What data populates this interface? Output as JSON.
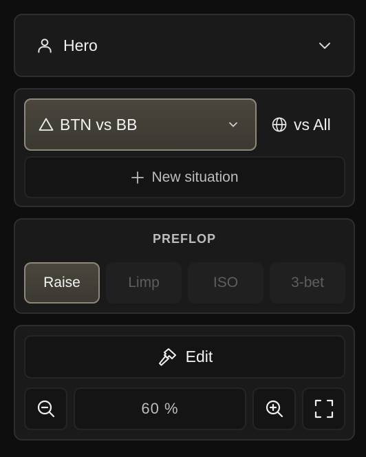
{
  "profile": {
    "name": "Hero",
    "icon": "user-icon",
    "dropdown_icon": "chevron-down-icon"
  },
  "situation": {
    "selected": "BTN vs BB",
    "selected_icon": "triangle-icon",
    "dropdown_icon": "chevron-down-icon",
    "opponent_filter": "vs All",
    "opponent_filter_icon": "globe-icon",
    "new_label": "New situation",
    "new_icon": "plus-icon"
  },
  "preflop": {
    "title": "PREFLOP",
    "actions": [
      {
        "label": "Raise",
        "active": true
      },
      {
        "label": "Limp",
        "active": false
      },
      {
        "label": "ISO",
        "active": false
      },
      {
        "label": "3-bet",
        "active": false
      }
    ]
  },
  "editor": {
    "edit_label": "Edit",
    "edit_icon": "hammer-icon",
    "zoom_value": "60 %",
    "zoom_out_icon": "zoom-out-icon",
    "zoom_in_icon": "zoom-in-icon",
    "fullscreen_icon": "fullscreen-icon"
  },
  "colors": {
    "background": "#0e0e0e",
    "panel": "#1a1a1a",
    "active_fill": "#4a463d",
    "active_border": "#8d8878",
    "muted_text": "#5e5e5e"
  }
}
